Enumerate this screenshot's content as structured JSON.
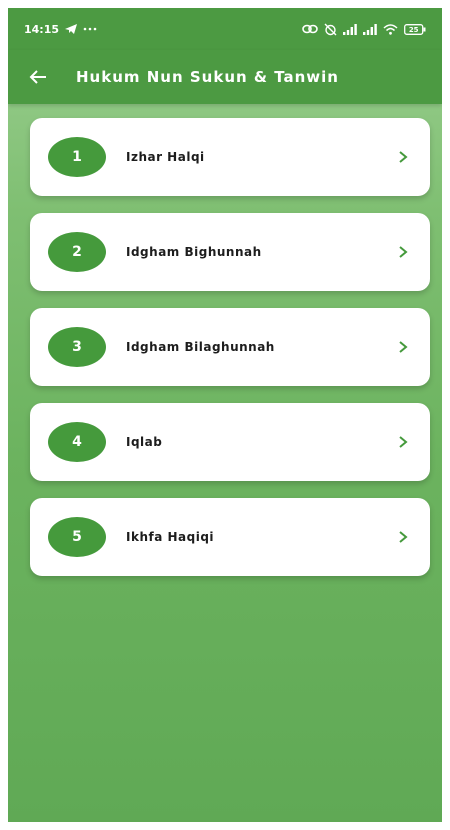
{
  "status_bar": {
    "time": "14:15",
    "battery": "25",
    "icons": [
      "telegram-icon",
      "more-icon",
      "link-icon",
      "alarm-off-icon",
      "signal-icon",
      "signal-icon",
      "wifi-icon",
      "battery-icon"
    ]
  },
  "app_bar": {
    "title": "Hukum Nun Sukun & Tanwin",
    "back_icon": "arrow-left-icon"
  },
  "colors": {
    "primary": "#4c9a42",
    "number_circle": "#459a3c",
    "card": "#ffffff",
    "chevron": "#459a3c"
  },
  "items": [
    {
      "number": "1",
      "label": "Izhar Halqi",
      "icon": "chevron-right-icon"
    },
    {
      "number": "2",
      "label": "Idgham Bighunnah",
      "icon": "chevron-right-icon"
    },
    {
      "number": "3",
      "label": "Idgham Bilaghunnah",
      "icon": "chevron-right-icon"
    },
    {
      "number": "4",
      "label": "Iqlab",
      "icon": "chevron-right-icon"
    },
    {
      "number": "5",
      "label": "Ikhfa Haqiqi",
      "icon": "chevron-right-icon"
    }
  ]
}
